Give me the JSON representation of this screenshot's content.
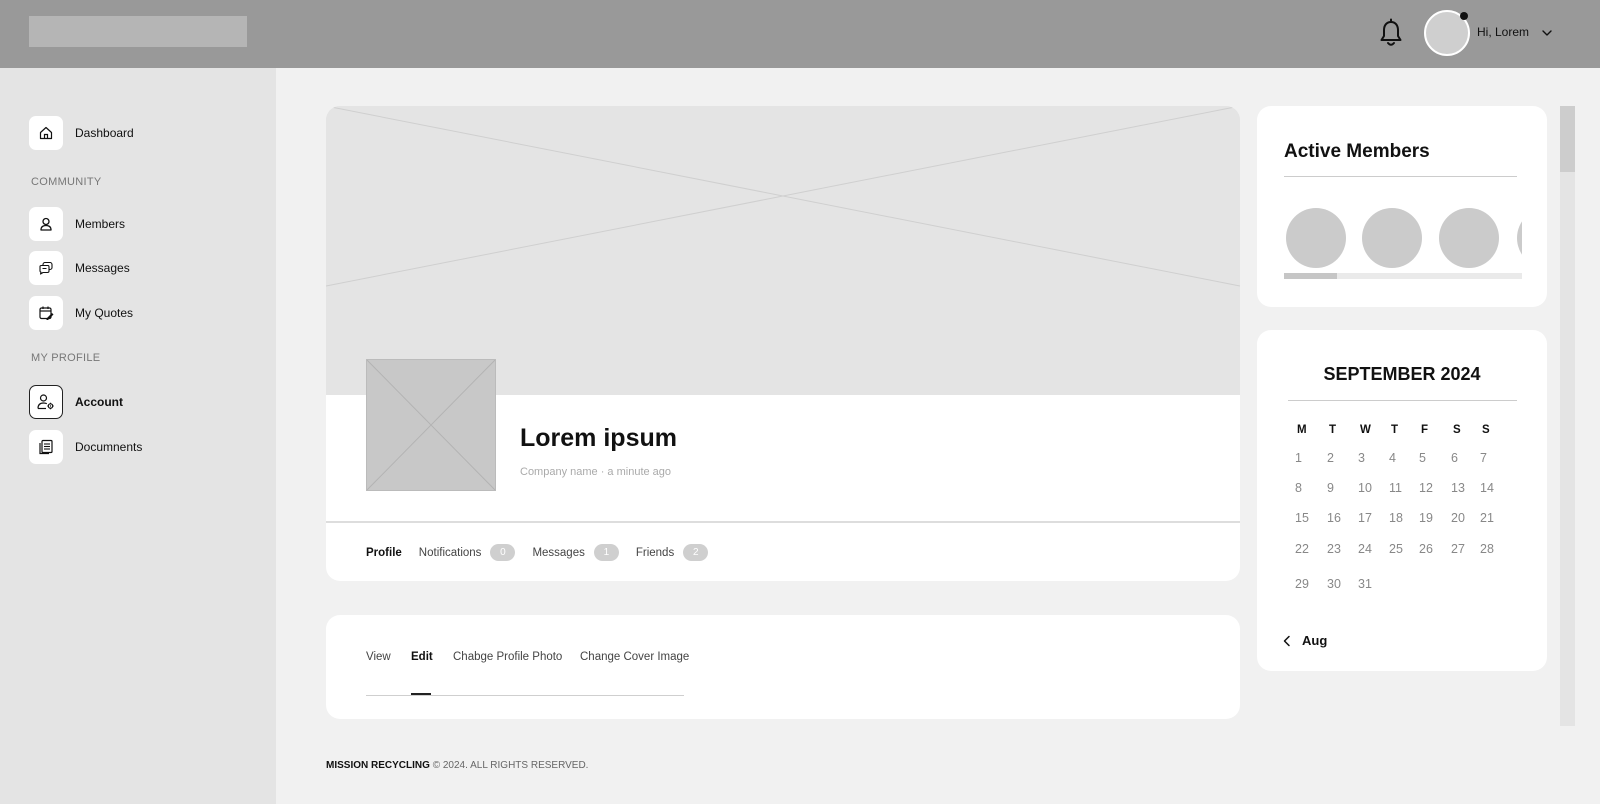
{
  "header": {
    "greeting": "Hi, Lorem",
    "icons": [
      "bell-icon",
      "chevron-down-icon"
    ]
  },
  "sidebar": {
    "items": [
      {
        "label": "Dashboard",
        "icon": "home-icon"
      },
      {
        "label": "Members",
        "icon": "user-icon"
      },
      {
        "label": "Messages",
        "icon": "chat-icon"
      },
      {
        "label": "My Quotes",
        "icon": "calendar-edit-icon"
      },
      {
        "label": "Account",
        "icon": "user-settings-icon",
        "active": true
      },
      {
        "label": "Documnents",
        "icon": "document-icon"
      }
    ],
    "sections": {
      "community": "COMMUNITY",
      "my_profile": "MY PROFILE"
    }
  },
  "profile": {
    "name": "Lorem ipsum",
    "meta": "Company name · a minute ago",
    "tabs": [
      {
        "label": "Profile",
        "active": true
      },
      {
        "label": "Notifications",
        "count": "0"
      },
      {
        "label": "Messages",
        "count": "1"
      },
      {
        "label": "Friends",
        "count": "2"
      }
    ]
  },
  "edit_tabs": [
    {
      "label": "View"
    },
    {
      "label": "Edit",
      "active": true
    },
    {
      "label": "Chabge Profile Photo"
    },
    {
      "label": "Change Cover Image"
    }
  ],
  "footer": {
    "brand": "MISSION RECYCLING",
    "copyright": "© 2024. ALL RIGHTS RESERVED."
  },
  "active_members": {
    "title": "Active Members",
    "scroll_position": 0.22
  },
  "calendar": {
    "title": "SEPTEMBER 2024",
    "weekdays": [
      "M",
      "T",
      "W",
      "T",
      "F",
      "S",
      "S"
    ],
    "weeks": [
      [
        "1",
        "2",
        "3",
        "4",
        "5",
        "6",
        "7"
      ],
      [
        "8",
        "9",
        "10",
        "11",
        "12",
        "13",
        "14"
      ],
      [
        "15",
        "16",
        "17",
        "18",
        "19",
        "20",
        "21"
      ],
      [
        "22",
        "23",
        "24",
        "25",
        "26",
        "27",
        "28"
      ],
      [
        "29",
        "30",
        "31"
      ]
    ],
    "prev_label": "Aug"
  }
}
